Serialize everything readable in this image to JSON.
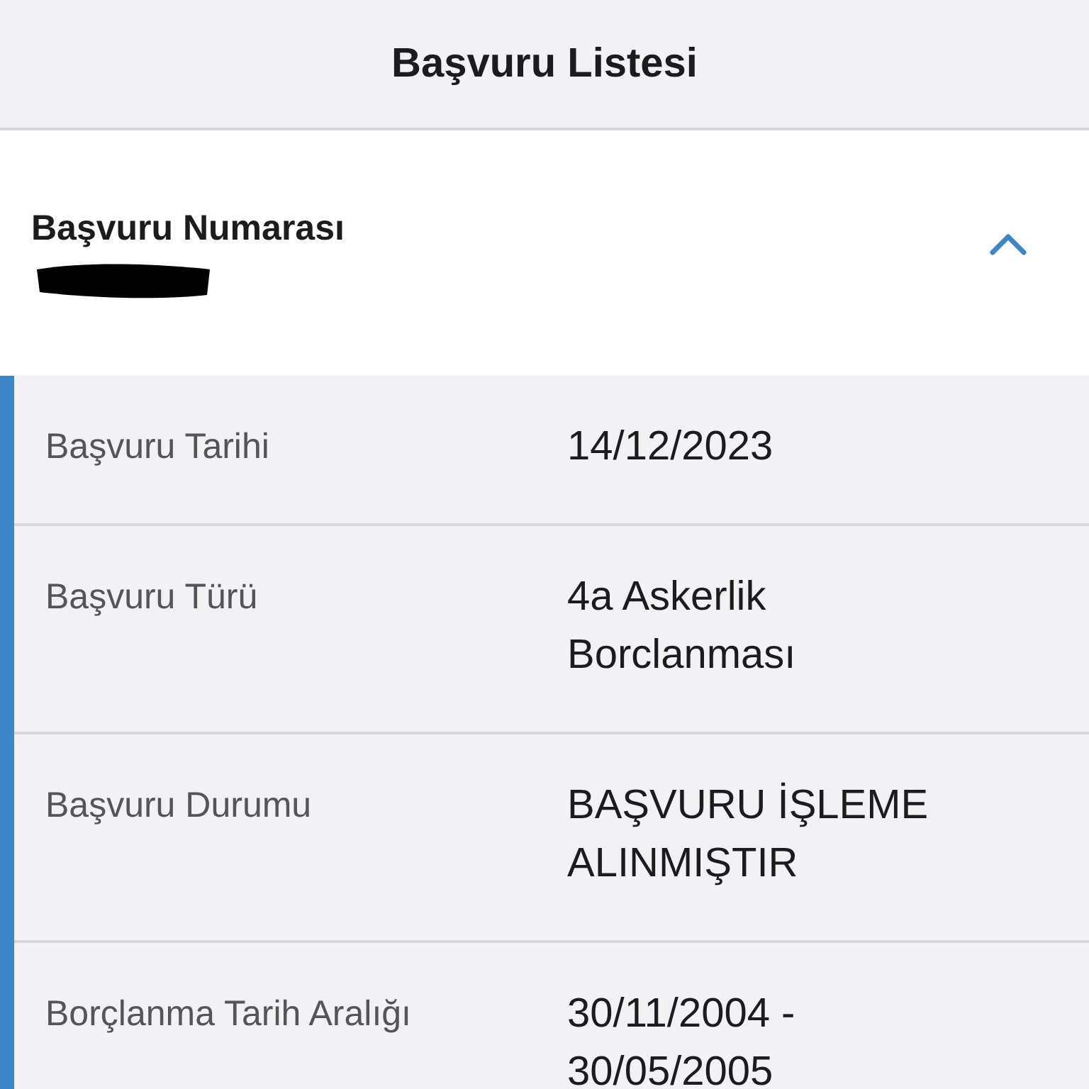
{
  "header": {
    "title": "Başvuru Listesi"
  },
  "application": {
    "label": "Başvuru Numarası",
    "expanded": true,
    "details": [
      {
        "label": "Başvuru Tarihi",
        "value": "14/12/2023"
      },
      {
        "label": "Başvuru Türü",
        "value": "4a Askerlik Borclanması"
      },
      {
        "label": "Başvuru Durumu",
        "value": "BAŞVURU İŞLEME ALINMIŞTIR"
      },
      {
        "label": "Borçlanma Tarih Aralığı",
        "value": "30/11/2004 - 30/05/2005"
      }
    ]
  }
}
